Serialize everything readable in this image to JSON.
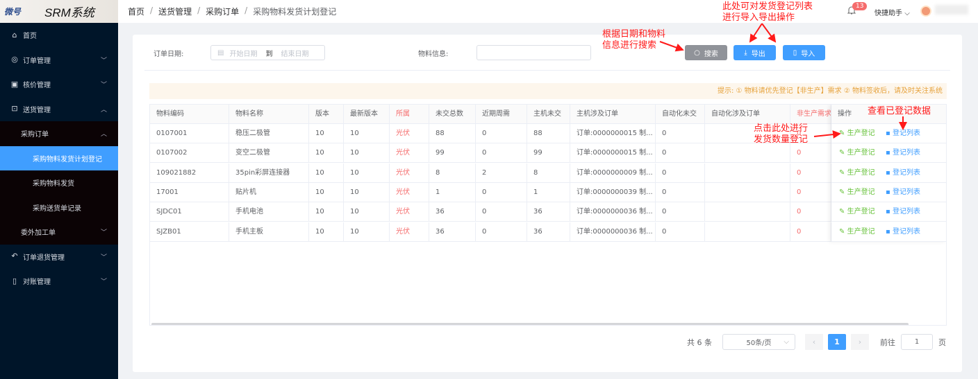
{
  "logo": {
    "brand": "微号",
    "system": "SRM系统"
  },
  "breadcrumb": [
    "首页",
    "送货管理",
    "采购订单",
    "采购物料发货计划登记"
  ],
  "header": {
    "notification_count": "13",
    "helper": "快捷助手"
  },
  "sidebar": {
    "items": [
      {
        "label": "首页",
        "icon": "home-icon"
      },
      {
        "label": "订单管理",
        "icon": "check-circle-icon"
      },
      {
        "label": "核价管理",
        "icon": "price-icon"
      },
      {
        "label": "送货管理",
        "icon": "box-icon"
      },
      {
        "label": "采购订单"
      },
      {
        "label": "采购物料发货计划登记"
      },
      {
        "label": "采购物料发货"
      },
      {
        "label": "采购送货单记录"
      },
      {
        "label": "委外加工单"
      },
      {
        "label": "订单退货管理",
        "icon": "return-icon"
      },
      {
        "label": "对账管理",
        "icon": "book-icon"
      }
    ]
  },
  "filters": {
    "date_label": "订单日期:",
    "start_placeholder": "开始日期",
    "to": "到",
    "end_placeholder": "结束日期",
    "material_label": "物料信息:",
    "material_value": ""
  },
  "buttons": {
    "search": "搜索",
    "export": "导出",
    "import": "导入"
  },
  "tip": "提示: ① 物料请优先登记【非生产】需求 ② 物料签收后，请及时关注系统",
  "table": {
    "columns": [
      "物料编码",
      "物料名称",
      "版本",
      "最新版本",
      "所属",
      "未交总数",
      "近期周需",
      "主机未交",
      "主机涉及订单",
      "自动化未交",
      "自动化涉及订单",
      "非生产需求",
      "操作"
    ],
    "rows": [
      [
        "0107001",
        "稳压二极管",
        "10",
        "10",
        "光伏",
        "88",
        "0",
        "88",
        "订单:0000000015 制...",
        "0",
        "",
        "0"
      ],
      [
        "0107002",
        "变空二极管",
        "10",
        "10",
        "光伏",
        "99",
        "0",
        "99",
        "订单:0000000015 制...",
        "0",
        "",
        "0"
      ],
      [
        "109021882",
        "35pin彩屏连接器",
        "10",
        "10",
        "光伏",
        "8",
        "2",
        "8",
        "订单:0000000009 制...",
        "0",
        "",
        "0"
      ],
      [
        "17001",
        "贴片机",
        "10",
        "10",
        "光伏",
        "1",
        "0",
        "1",
        "订单:0000000039 制...",
        "0",
        "",
        "0"
      ],
      [
        "SJDC01",
        "手机电池",
        "10",
        "10",
        "光伏",
        "36",
        "0",
        "36",
        "订单:0000000036 制...",
        "0",
        "",
        "0"
      ],
      [
        "SJZB01",
        "手机主板",
        "10",
        "10",
        "光伏",
        "36",
        "0",
        "36",
        "订单:0000000036 制...",
        "0",
        "",
        "0"
      ]
    ],
    "action_register": "生产登记",
    "action_list": "登记列表"
  },
  "pagination": {
    "total": "共 6 条",
    "page_size": "50条/页",
    "current": "1",
    "goto_label": "前往",
    "goto_value": "1",
    "page_suffix": "页"
  },
  "annotations": {
    "import_export": [
      "此处可对发货登记列表",
      "进行导入导出操作"
    ],
    "search": [
      "根据日期和物料",
      "信息进行搜索"
    ],
    "register": [
      "点击此处进行",
      "发货数量登记"
    ],
    "view": "查看已登记数据"
  },
  "colors": {
    "primary": "#409eff",
    "sidebar": "#001529",
    "danger": "#f56c6c",
    "success": "#67c23a",
    "annotation": "#ff1a1a"
  }
}
